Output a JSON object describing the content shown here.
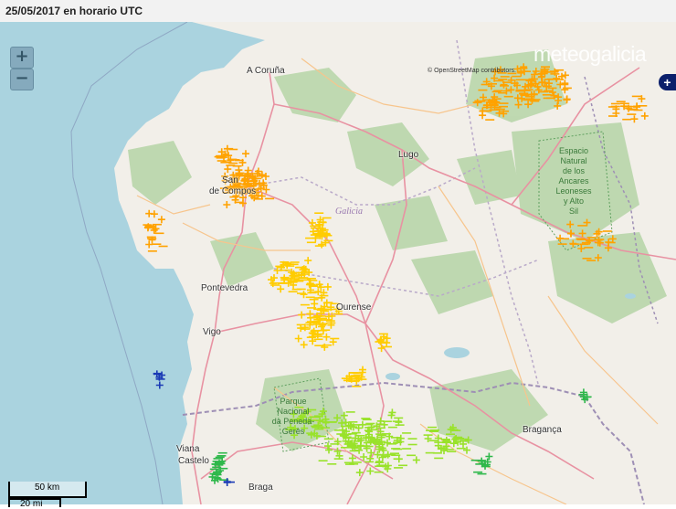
{
  "title": "25/05/2017 en horario UTC",
  "zoom": {
    "in_label": "+",
    "out_label": "−"
  },
  "attribution": "© OpenStreetMap contributors.",
  "brand": "meteogalicia",
  "layers_button": "+",
  "cities": {
    "a_coruna": "A Coruña",
    "lugo": "Lugo",
    "santiago_1": "San",
    "santiago_2": "de Compos",
    "pontevedra": "Pontevedra",
    "vigo": "Vigo",
    "ourense": "Ourense",
    "braganca": "Bragança",
    "viana_1": "Viana",
    "viana_2": "Castelo",
    "braga": "Braga"
  },
  "region": "Galicia",
  "parks": {
    "ancares": [
      "Espacio",
      "Natural",
      "de los",
      "Ancares",
      "Leoneses",
      "y Alto",
      "Sil"
    ],
    "geres": [
      "Parque",
      "Nacional",
      "da Peneda-",
      "Gerês"
    ]
  },
  "scale": {
    "km_label": "50 km",
    "mi_label": "20 mi"
  },
  "colors": {
    "sea": "#aad3df",
    "land": "#f2efe9",
    "forest": "#add19e",
    "road_primary": "#e892a2",
    "road_secondary": "#f7c58d",
    "border": "#9e8fb5",
    "strike_orange": "#ffa200",
    "strike_yellow": "#ffcc00",
    "strike_lime": "#99e22a",
    "strike_green": "#2eb84a",
    "strike_blue": "#1a3ab5"
  }
}
